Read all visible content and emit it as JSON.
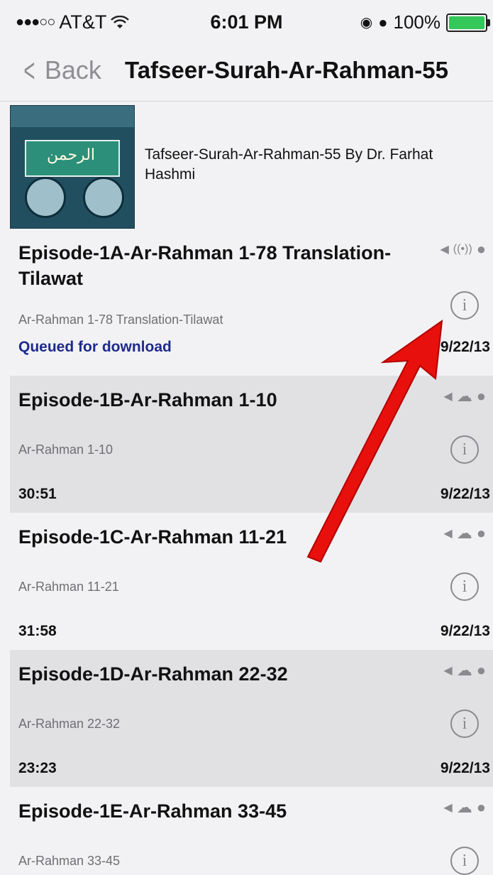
{
  "status_bar": {
    "carrier": "AT&T",
    "time": "6:01 PM",
    "battery": "100%",
    "battery_level": 1.0
  },
  "nav": {
    "back_label": "Back",
    "title": "Tafseer-Surah-Ar-Rahman-55"
  },
  "podcast": {
    "artwork_text": "الرحمن",
    "title": "Tafseer-Surah-Ar-Rahman-55 By Dr. Farhat Hashmi"
  },
  "episodes": [
    {
      "title": "Episode-1A-Ar-Rahman 1-78 Translation-Tilawat",
      "subtitle": "Ar-Rahman 1-78 Translation-Tilawat",
      "status": "Queued for download",
      "date": "9/22/13"
    },
    {
      "title": "Episode-1B-Ar-Rahman 1-10",
      "subtitle": "Ar-Rahman 1-10",
      "status": "30:51",
      "date": "9/22/13"
    },
    {
      "title": "Episode-1C-Ar-Rahman 11-21",
      "subtitle": "Ar-Rahman 11-21",
      "status": "31:58",
      "date": "9/22/13"
    },
    {
      "title": "Episode-1D-Ar-Rahman 22-32",
      "subtitle": "Ar-Rahman 22-32",
      "status": "23:23",
      "date": "9/22/13"
    },
    {
      "title": "Episode-1E-Ar-Rahman 33-45",
      "subtitle": "Ar-Rahman 33-45",
      "status": "",
      "date": ""
    }
  ],
  "icons": {
    "speaker": "speaker-icon",
    "cloud": "cloud-icon",
    "antenna": "antenna-icon",
    "dot": "unplayed-dot-icon",
    "info": "info-icon",
    "arrow": "annotation-arrow"
  },
  "colors": {
    "queued": "#1e2a8c",
    "arrow": "#e8100c",
    "battery": "#34c759"
  }
}
